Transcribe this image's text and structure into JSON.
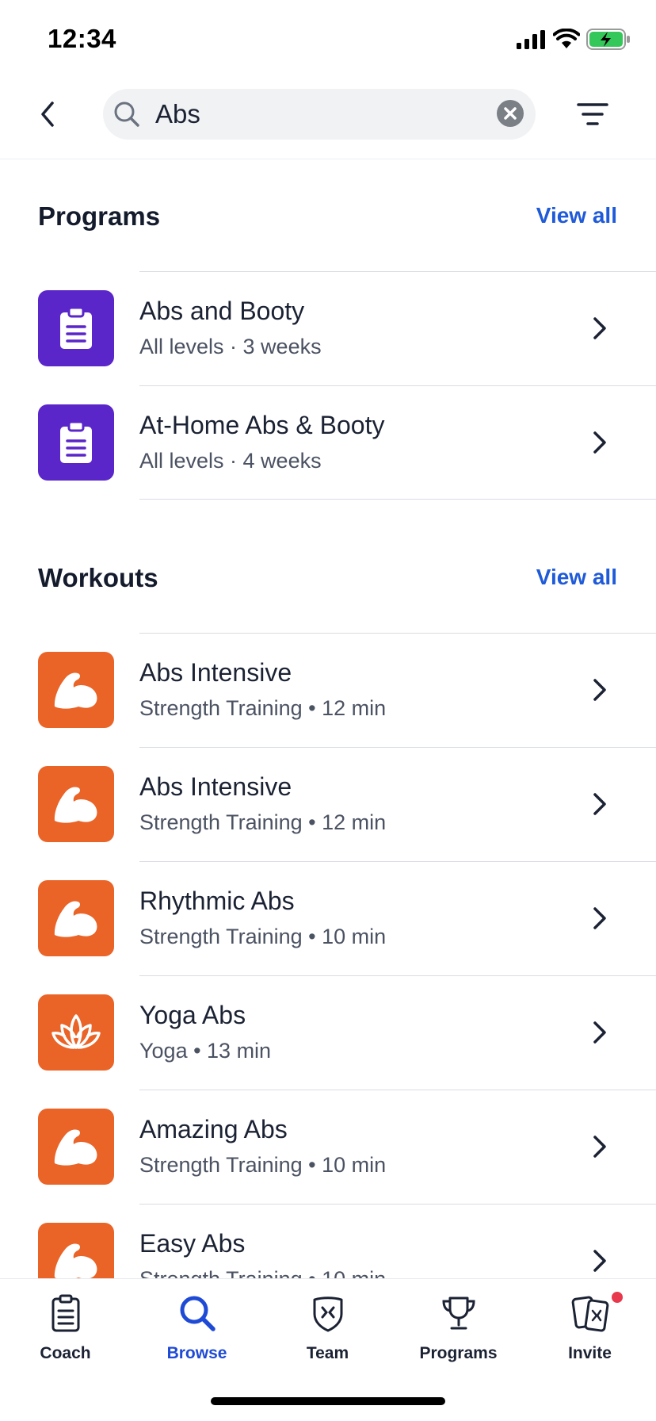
{
  "status_bar": {
    "time": "12:34"
  },
  "search": {
    "query": "Abs"
  },
  "programs": {
    "title": "Programs",
    "view_all": "View all",
    "items": [
      {
        "title": "Abs and Booty",
        "subtitle": "All levels · 3 weeks",
        "icon": "clipboard-icon"
      },
      {
        "title": "At-Home Abs & Booty",
        "subtitle": "All levels · 4 weeks",
        "icon": "clipboard-icon"
      }
    ]
  },
  "workouts": {
    "title": "Workouts",
    "view_all": "View all",
    "items": [
      {
        "title": "Abs Intensive",
        "subtitle": "Strength Training • 12 min",
        "icon": "muscle-icon"
      },
      {
        "title": "Abs Intensive",
        "subtitle": "Strength Training • 12 min",
        "icon": "muscle-icon"
      },
      {
        "title": "Rhythmic Abs",
        "subtitle": "Strength Training • 10 min",
        "icon": "muscle-icon"
      },
      {
        "title": "Yoga Abs",
        "subtitle": "Yoga • 13 min",
        "icon": "lotus-icon"
      },
      {
        "title": "Amazing Abs",
        "subtitle": "Strength Training • 10 min",
        "icon": "muscle-icon"
      },
      {
        "title": "Easy Abs",
        "subtitle": "Strength Training • 10 min",
        "icon": "muscle-icon"
      }
    ]
  },
  "tab_bar": {
    "tabs": [
      {
        "label": "Coach",
        "icon": "clipboard-icon"
      },
      {
        "label": "Browse",
        "icon": "search-icon",
        "active": true
      },
      {
        "label": "Team",
        "icon": "shield-icon"
      },
      {
        "label": "Programs",
        "icon": "trophy-icon"
      },
      {
        "label": "Invite",
        "icon": "invite-phones-icon",
        "badge": true
      }
    ]
  },
  "colors": {
    "accent": "#1f4ad6",
    "link": "#1f5ad8",
    "program_thumb": "#5a25c9",
    "workout_thumb": "#ea6327",
    "badge": "#e8384d"
  }
}
